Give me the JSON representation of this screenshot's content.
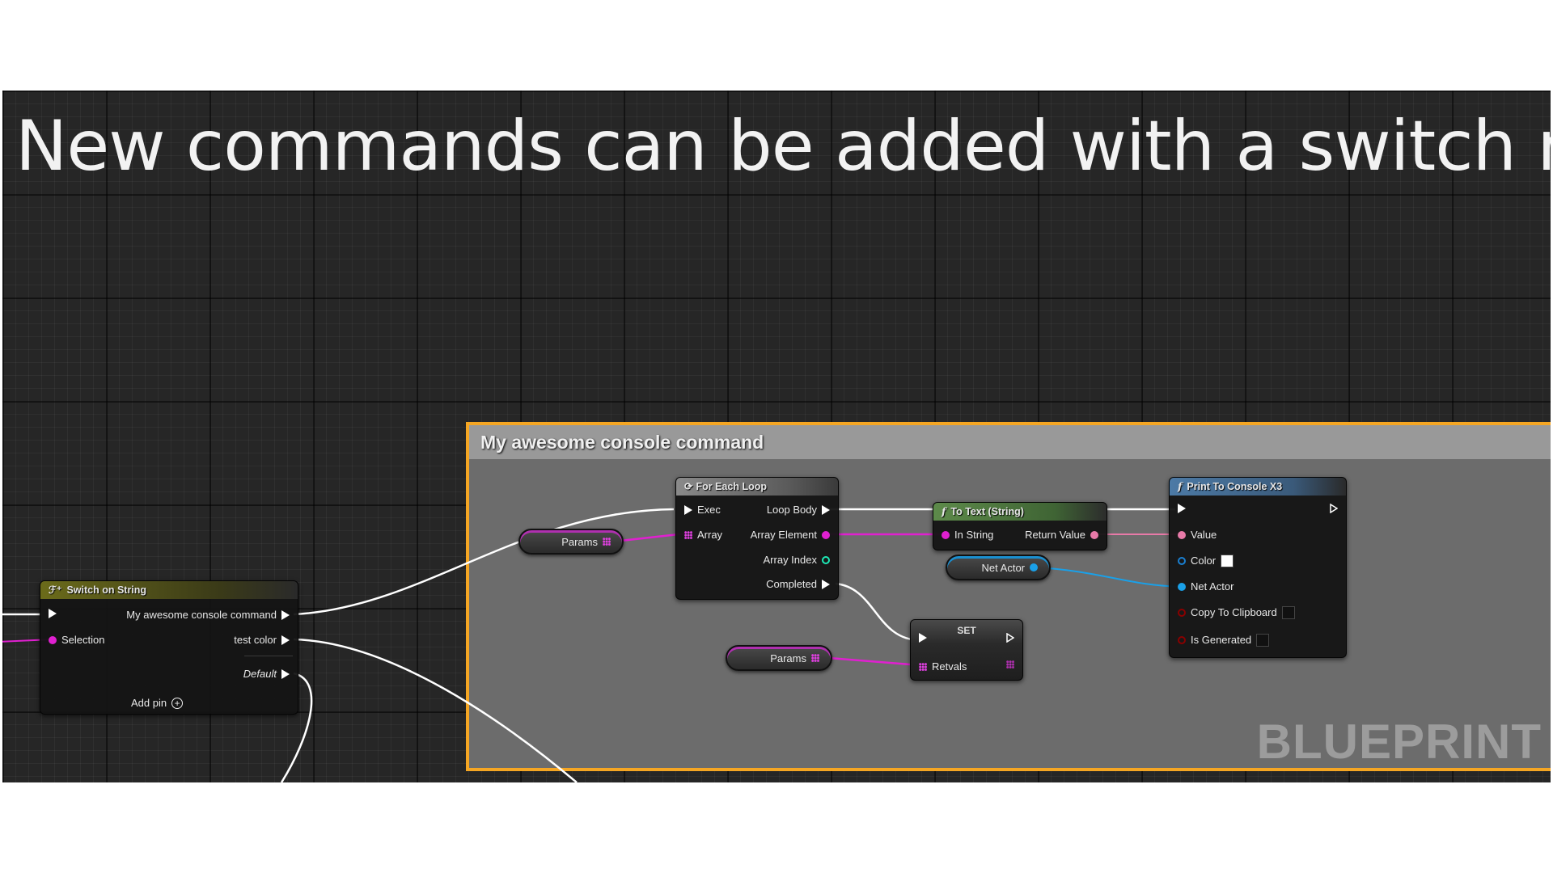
{
  "headline": "New commands can be added with a switch node.",
  "comment_box": {
    "title": "My awesome console command",
    "accent": "#f5a623"
  },
  "watermark": "BLUEPRINT",
  "nodes": {
    "switch_on_string": {
      "title": "Switch on String",
      "icon": "switch-icon",
      "inputs": [
        "Selection"
      ],
      "outputs": [
        "My awesome console command",
        "test color",
        "Default"
      ],
      "add_pin": "Add pin"
    },
    "for_each_loop": {
      "title": "For Each Loop",
      "icon": "loop-icon",
      "inputs": [
        "Exec",
        "Array"
      ],
      "outputs": [
        "Loop Body",
        "Array Element",
        "Array Index",
        "Completed"
      ]
    },
    "to_text": {
      "title": "To Text (String)",
      "icon": "function-icon",
      "inputs": [
        "In String"
      ],
      "outputs": [
        "Return Value"
      ]
    },
    "print_to_console": {
      "title": "Print To Console X3",
      "icon": "function-icon",
      "inputs": [
        "Value",
        "Color",
        "Net Actor",
        "Copy To Clipboard",
        "Is Generated"
      ]
    },
    "set": {
      "title": "SET",
      "inputs": [
        "Retvals"
      ]
    },
    "params_var_1": {
      "label": "Params"
    },
    "params_var_2": {
      "label": "Params"
    },
    "net_actor_var": {
      "label": "Net Actor"
    }
  },
  "colors": {
    "string_pin": "#e020d0",
    "object_pin": "#1aa0e8",
    "int_pin": "#1de9b6",
    "text_pin": "#e87aa8",
    "bool_pin": "#8a0000",
    "switch_header": "#6b6b1a",
    "function_header": "#4c7aa6",
    "pure_header": "#5d8a4a"
  }
}
